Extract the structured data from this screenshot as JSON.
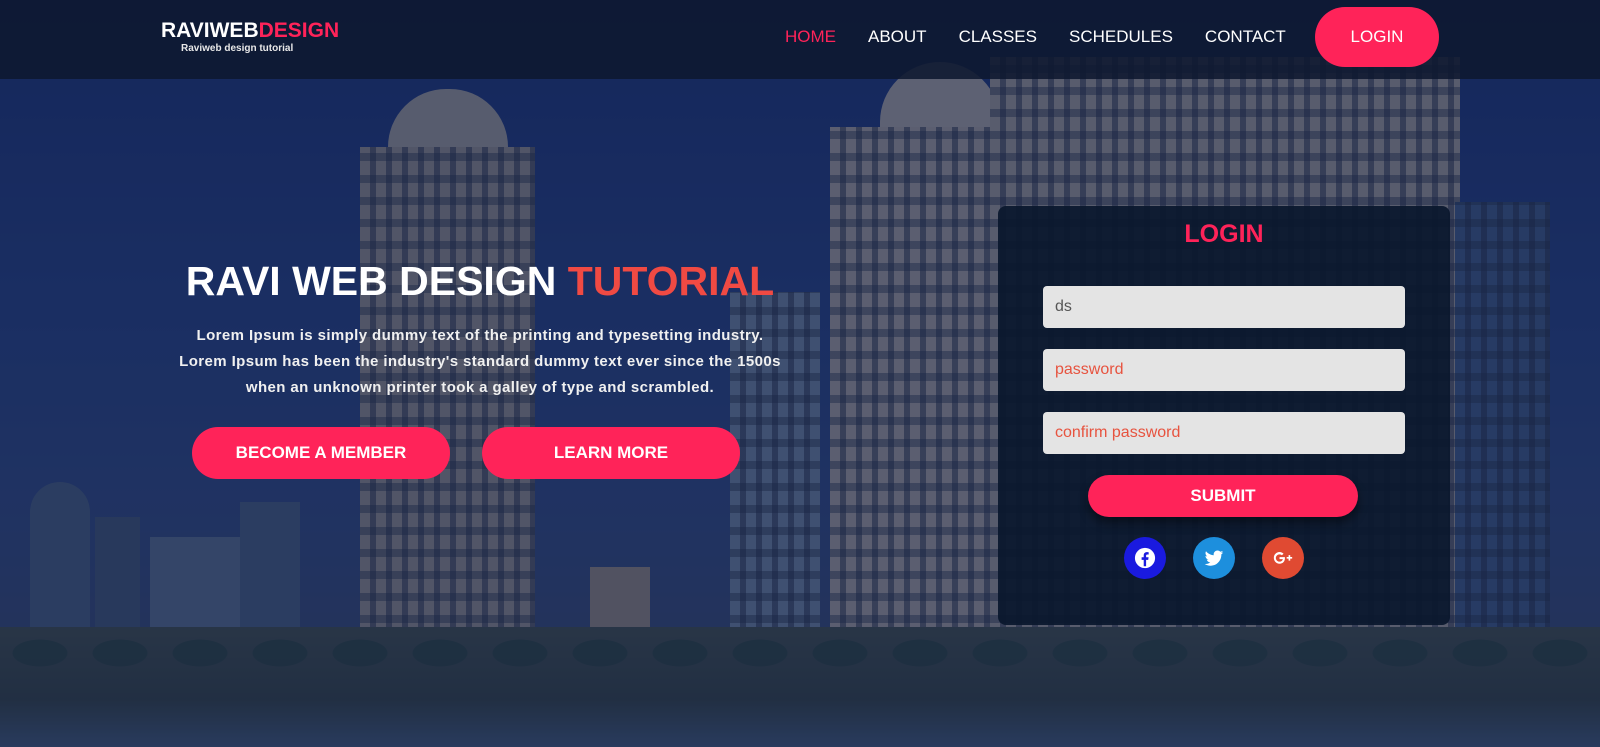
{
  "brand": {
    "name_part1": "RAVIWEB",
    "name_part2": "DESIGN",
    "tagline": "Raviweb design tutorial"
  },
  "nav": {
    "items": [
      {
        "label": "HOME",
        "active": true
      },
      {
        "label": "ABOUT",
        "active": false
      },
      {
        "label": "CLASSES",
        "active": false
      },
      {
        "label": "SCHEDULES",
        "active": false
      },
      {
        "label": "CONTACT",
        "active": false
      }
    ],
    "login_label": "LOGIN"
  },
  "hero": {
    "title_part1": "RAVI WEB DESIGN ",
    "title_part2": "TUTORIAL",
    "line1": "Lorem Ipsum is simply dummy text of the printing and typesetting industry.",
    "line2": "Lorem Ipsum has been the industry's standard dummy text ever since the 1500s",
    "line3": "when an unknown printer took a galley of type and scrambled.",
    "primary_button": "BECOME A MEMBER",
    "secondary_button": "LEARN MORE"
  },
  "login_form": {
    "title": "LOGIN",
    "username_value": "ds",
    "password_placeholder": "password",
    "confirm_placeholder": "confirm password",
    "submit_label": "SUBMIT",
    "socials": [
      {
        "icon": "facebook-icon",
        "color": "#1a1adf"
      },
      {
        "icon": "twitter-icon",
        "color": "#1d8fdd"
      },
      {
        "icon": "google-plus-icon",
        "color": "#e04a32"
      }
    ]
  },
  "colors": {
    "accent": "#ff2359",
    "title_accent": "#f04a43",
    "nav_background": "#0e1830",
    "card_background": "#0a182d"
  }
}
